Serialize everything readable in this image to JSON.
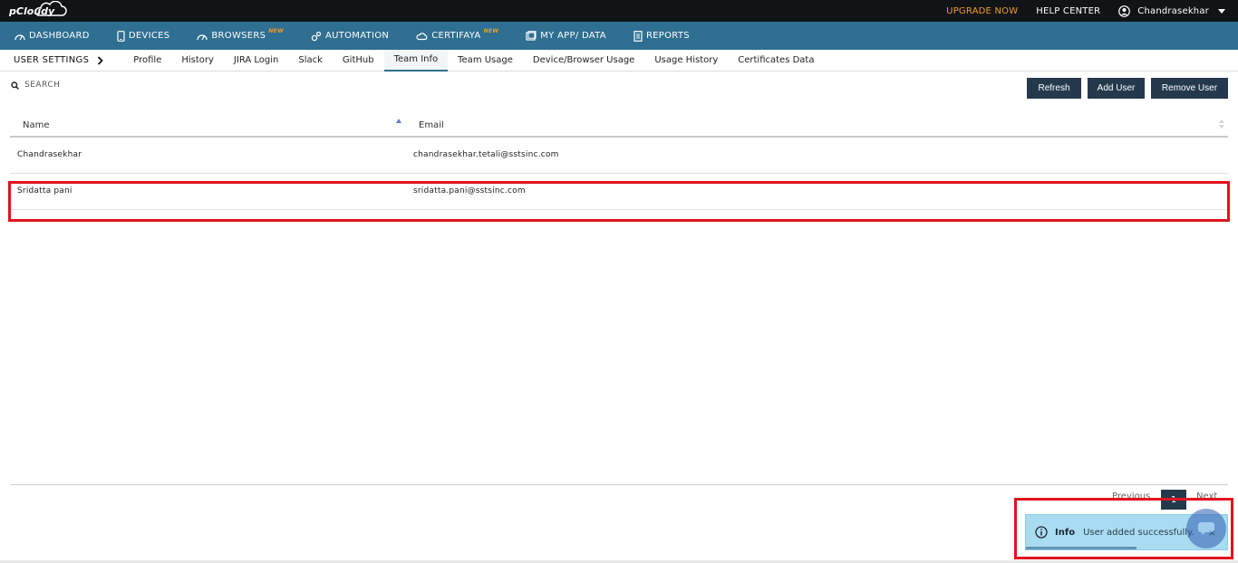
{
  "topbar": {
    "logo_text": "pCloudy",
    "upgrade": "UPGRADE NOW",
    "help": "HELP CENTER",
    "user_name": "Chandrasekhar"
  },
  "nav": {
    "items": [
      {
        "label": "DASHBOARD",
        "icon": "gauge-icon",
        "badge": ""
      },
      {
        "label": "DEVICES",
        "icon": "phone-icon",
        "badge": ""
      },
      {
        "label": "BROWSERS",
        "icon": "gauge-icon",
        "badge": "NEW"
      },
      {
        "label": "AUTOMATION",
        "icon": "gears-icon",
        "badge": ""
      },
      {
        "label": "CERTIFAYA",
        "icon": "cloud-icon",
        "badge": "NEW"
      },
      {
        "label": "MY APP/ DATA",
        "icon": "folder-icon",
        "badge": ""
      },
      {
        "label": "REPORTS",
        "icon": "document-icon",
        "badge": ""
      }
    ]
  },
  "subnav": {
    "title": "USER SETTINGS",
    "tabs": [
      "Profile",
      "History",
      "JIRA Login",
      "Slack",
      "GitHub",
      "Team Info",
      "Team Usage",
      "Device/Browser Usage",
      "Usage History",
      "Certificates Data"
    ],
    "active_tab": "Team Info"
  },
  "search": {
    "label": "SEARCH"
  },
  "buttons": {
    "refresh": "Refresh",
    "add_user": "Add User",
    "remove_user": "Remove User"
  },
  "table": {
    "columns": [
      "Name",
      "Email"
    ],
    "rows": [
      {
        "name": "Chandrasekhar",
        "email": "chandrasekhar.tetali@sstsinc.com"
      },
      {
        "name": "Sridatta pani",
        "email": "sridatta.pani@sstsinc.com"
      }
    ]
  },
  "pagination": {
    "previous": "Previous",
    "page": "1",
    "next": "Next"
  },
  "toast": {
    "label": "Info",
    "message": "User added successfully.",
    "close": "×",
    "progress": 0.55
  },
  "colors": {
    "navbar": "#2f6f91",
    "topbar": "#111417",
    "accent_orange": "#f39a2c",
    "button": "#25394d",
    "highlight": "#e3121f",
    "toast_bg": "#a9dbf1"
  }
}
